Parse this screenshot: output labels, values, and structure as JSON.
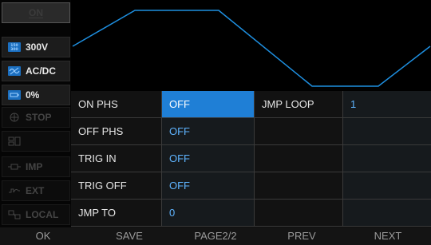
{
  "sidebar": {
    "on": {
      "label": "ON"
    },
    "voltage": {
      "label": "300V",
      "icon": "range-icon"
    },
    "mode": {
      "label": "AC/DC",
      "icon": "acdc-icon"
    },
    "level": {
      "label": "0%",
      "icon": "battery-icon"
    },
    "stop": {
      "label": "STOP",
      "icon": "stop-icon"
    },
    "blank": {
      "label": "",
      "icon": "meter-icon"
    },
    "imp": {
      "label": "IMP",
      "icon": "impedance-icon"
    },
    "ext": {
      "label": "EXT",
      "icon": "wave-ext-icon"
    },
    "local": {
      "label": "LOCAL",
      "icon": "local-icon"
    }
  },
  "table": {
    "rows": [
      {
        "label": "ON PHS",
        "value": "OFF",
        "label2": "JMP LOOP",
        "value2": "1"
      },
      {
        "label": "OFF PHS",
        "value": "OFF",
        "label2": "",
        "value2": ""
      },
      {
        "label": "TRIG IN",
        "value": "OFF",
        "label2": "",
        "value2": ""
      },
      {
        "label": "TRIG OFF",
        "value": "OFF",
        "label2": "",
        "value2": ""
      },
      {
        "label": "JMP TO",
        "value": "0",
        "label2": "",
        "value2": ""
      }
    ]
  },
  "softkeys": [
    "OK",
    "SAVE",
    "PAGE2/2",
    "PREV",
    "NEXT"
  ],
  "colors": {
    "accent": "#1f7fd6",
    "value": "#5fb4ff",
    "waveform": "#1e8fe0"
  }
}
